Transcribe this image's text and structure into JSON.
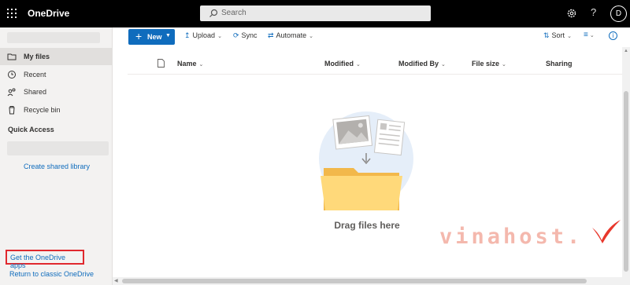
{
  "topbar": {
    "app_name": "OneDrive",
    "search_placeholder": "Search",
    "help_label": "?",
    "avatar_initial": "D",
    "icons": [
      "app-launcher-icon",
      "search-icon",
      "gear-icon",
      "help-icon"
    ]
  },
  "sidebar": {
    "items": [
      {
        "label": "My files",
        "icon": "folder-icon",
        "selected": true
      },
      {
        "label": "Recent",
        "icon": "clock-icon",
        "selected": false
      },
      {
        "label": "Shared",
        "icon": "people-icon",
        "selected": false
      },
      {
        "label": "Recycle bin",
        "icon": "trash-icon",
        "selected": false
      }
    ],
    "quick_access_title": "Quick Access",
    "create_library_link": "Create shared library",
    "get_apps_link": "Get the OneDrive apps",
    "return_classic_link": "Return to classic OneDrive"
  },
  "commandbar": {
    "new_label": "New",
    "upload_label": "Upload",
    "sync_label": "Sync",
    "automate_label": "Automate",
    "sort_label": "Sort"
  },
  "file_table": {
    "columns": [
      "Name",
      "Modified",
      "Modified By",
      "File size",
      "Sharing"
    ]
  },
  "empty_state": {
    "message": "Drag files here"
  },
  "watermark": {
    "text": "vinahost."
  },
  "colors": {
    "accent": "#0f6cbd",
    "topbar_bg": "#000000",
    "sidebar_bg": "#f3f2f1",
    "highlight_box": "#e0282e",
    "watermark": "#f4b8ad",
    "watermark_check": "#e8372b"
  }
}
